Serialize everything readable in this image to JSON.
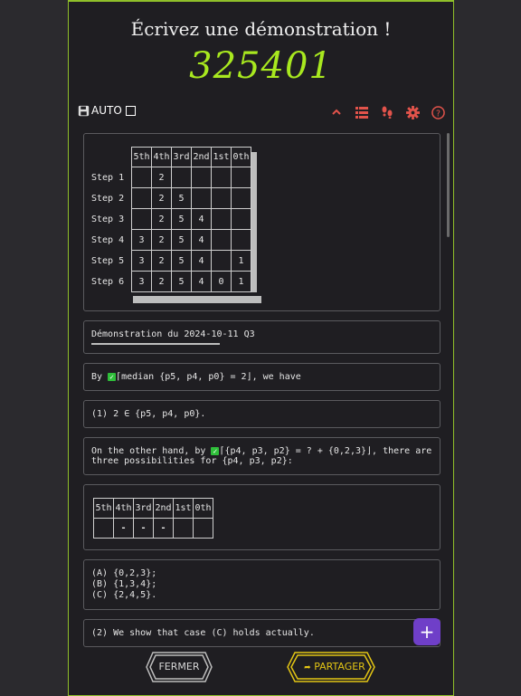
{
  "title": "Écrivez une démonstration !",
  "code": "325401",
  "toolbar": {
    "auto_label": "AUTO",
    "icons": [
      "save-icon",
      "chevron-up-icon",
      "list-icon",
      "footprints-icon",
      "gear-icon",
      "help-icon"
    ]
  },
  "table1": {
    "headers": [
      "5th",
      "4th",
      "3rd",
      "2nd",
      "1st",
      "0th"
    ],
    "rows": [
      {
        "label": "Step 1",
        "cells": [
          "",
          "2",
          "",
          "",
          "",
          ""
        ]
      },
      {
        "label": "Step 2",
        "cells": [
          "",
          "2",
          "5",
          "",
          "",
          ""
        ]
      },
      {
        "label": "Step 3",
        "cells": [
          "",
          "2",
          "5",
          "4",
          "",
          ""
        ]
      },
      {
        "label": "Step 4",
        "cells": [
          "3",
          "2",
          "5",
          "4",
          "",
          ""
        ]
      },
      {
        "label": "Step 5",
        "cells": [
          "3",
          "2",
          "5",
          "4",
          "",
          "1"
        ]
      },
      {
        "label": "Step 6",
        "cells": [
          "3",
          "2",
          "5",
          "4",
          "0",
          "1"
        ]
      }
    ]
  },
  "demo_title": "Démonstration du 2024-10-11 Q3",
  "para1": {
    "prefix": "By ",
    "text": "⌈median {p5, p4, p0} = 2⌋, we have"
  },
  "para2": "(1) 2 ∈ {p5, p4, p0}.",
  "para3": {
    "prefix": "On the other hand, by ",
    "text": "⌈{p4, p3, p2} = ? + {0,2,3}⌋, there are three possibilities for {p4, p3, p2}:"
  },
  "table2": {
    "headers": [
      "5th",
      "4th",
      "3rd",
      "2nd",
      "1st",
      "0th"
    ],
    "cells": [
      "",
      "-",
      "-",
      "-",
      "",
      ""
    ]
  },
  "options": [
    "(A) {0,2,3};",
    "(B) {1,3,4};",
    "(C) {2,4,5}."
  ],
  "para4": "(2) We show that case (C) holds actually.",
  "fab_label": "+",
  "buttons": {
    "close": "FERMER",
    "share": "PARTAGER"
  },
  "colors": {
    "accent": "#a8e81f",
    "share": "#e3c514",
    "close": "#bdbdbd",
    "fab": "#6f3fc8",
    "check": "#2fbf3a",
    "icons": "#e2534b"
  }
}
